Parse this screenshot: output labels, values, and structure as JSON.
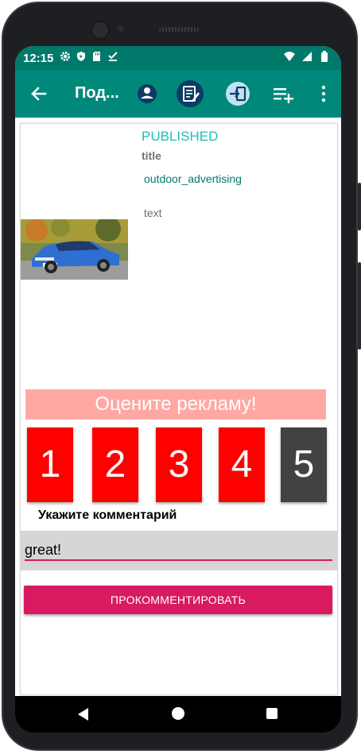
{
  "status_bar": {
    "time": "12:15",
    "left_icons": [
      "gear-icon",
      "shield-icon",
      "sd-card-icon",
      "check-download-icon"
    ],
    "right_icons": [
      "wifi-icon",
      "signal-icon",
      "battery-icon"
    ]
  },
  "app_bar": {
    "title": "Под...",
    "back_icon": "arrow-left-icon",
    "actions": [
      "profile-icon",
      "edit-note-icon",
      "login-icon",
      "playlist-add-icon",
      "more-vert-icon"
    ]
  },
  "ad": {
    "status": "PUBLISHED",
    "title": "title",
    "category": "outdoor_advertising",
    "text": "text",
    "image": "car-photo"
  },
  "rating": {
    "banner": "Оцените рекламу!",
    "options": [
      "1",
      "2",
      "3",
      "4",
      "5"
    ],
    "selected": "5"
  },
  "comment": {
    "label": "Укажите комментарий",
    "value": "great!",
    "submit_label": "ПРОКОММЕНТИРОВАТЬ"
  },
  "colors": {
    "status_bar": "#00796b",
    "app_bar": "#00897b",
    "accent": "#d81b60",
    "rating_button": "#ff0000",
    "rating_selected": "#424242",
    "banner": "#ffa8a3"
  }
}
